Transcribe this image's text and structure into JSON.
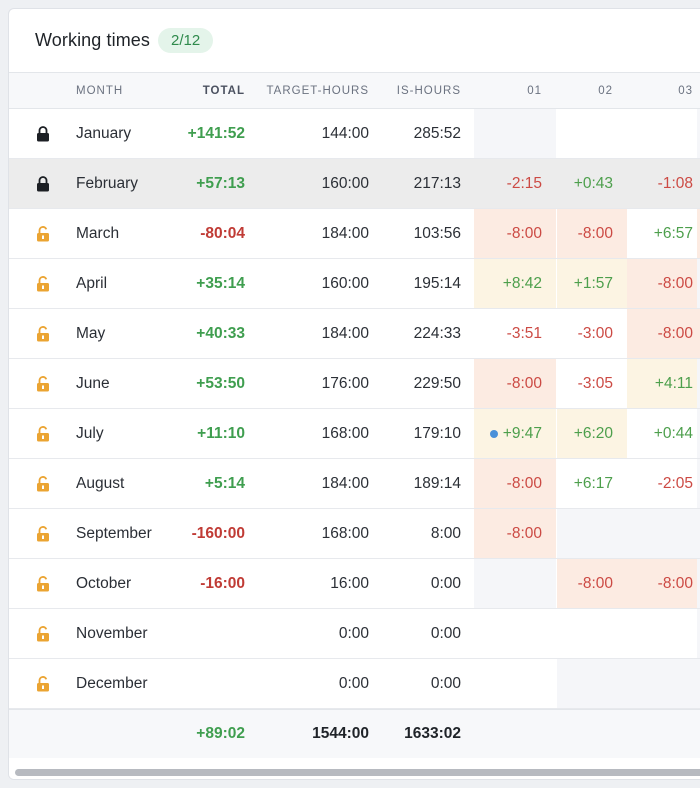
{
  "header": {
    "title": "Working times",
    "badge": "2/12"
  },
  "columns": {
    "month": "MONTH",
    "total": "TOTAL",
    "target": "TARGET-HOURS",
    "is": "IS-HOURS",
    "day1": "01",
    "day2": "02",
    "day3": "03"
  },
  "rows": [
    {
      "lock": "locked",
      "month": "January",
      "total": "+141:52",
      "target": "144:00",
      "is": "285:52",
      "d1": "",
      "d2": "",
      "d3": ""
    },
    {
      "lock": "locked",
      "month": "February",
      "total": "+57:13",
      "target": "160:00",
      "is": "217:13",
      "d1": "-2:15",
      "d2": "+0:43",
      "d3": "-1:08"
    },
    {
      "lock": "unlocked",
      "month": "March",
      "total": "-80:04",
      "target": "184:00",
      "is": "103:56",
      "d1": "-8:00",
      "d2": "-8:00",
      "d3": "+6:57"
    },
    {
      "lock": "unlocked",
      "month": "April",
      "total": "+35:14",
      "target": "160:00",
      "is": "195:14",
      "d1": "+8:42",
      "d2": "+1:57",
      "d3": "-8:00"
    },
    {
      "lock": "unlocked",
      "month": "May",
      "total": "+40:33",
      "target": "184:00",
      "is": "224:33",
      "d1": "-3:51",
      "d2": "-3:00",
      "d3": "-8:00"
    },
    {
      "lock": "unlocked",
      "month": "June",
      "total": "+53:50",
      "target": "176:00",
      "is": "229:50",
      "d1": "-8:00",
      "d2": "-3:05",
      "d3": "+4:11"
    },
    {
      "lock": "unlocked",
      "month": "July",
      "total": "+11:10",
      "target": "168:00",
      "is": "179:10",
      "d1": "+9:47",
      "d2": "+6:20",
      "d3": "+0:44"
    },
    {
      "lock": "unlocked",
      "month": "August",
      "total": "+5:14",
      "target": "184:00",
      "is": "189:14",
      "d1": "-8:00",
      "d2": "+6:17",
      "d3": "-2:05"
    },
    {
      "lock": "unlocked",
      "month": "September",
      "total": "-160:00",
      "target": "168:00",
      "is": "8:00",
      "d1": "-8:00",
      "d2": "",
      "d3": ""
    },
    {
      "lock": "unlocked",
      "month": "October",
      "total": "-16:00",
      "target": "16:00",
      "is": "0:00",
      "d1": "",
      "d2": "-8:00",
      "d3": "-8:00"
    },
    {
      "lock": "unlocked",
      "month": "November",
      "total": "",
      "target": "0:00",
      "is": "0:00",
      "d1": "",
      "d2": "",
      "d3": ""
    },
    {
      "lock": "unlocked",
      "month": "December",
      "total": "",
      "target": "0:00",
      "is": "0:00",
      "d1": "",
      "d2": "",
      "d3": ""
    }
  ],
  "footer": {
    "total": "+89:02",
    "target": "1544:00",
    "is": "1633:02"
  },
  "colors": {
    "positive": "#3f9e4f",
    "negative": "#c03b35",
    "locked_icon": "#1c1f24",
    "unlocked_icon": "#eba432",
    "badge_bg": "#e4f4ea",
    "today_dot": "#4a90d9"
  },
  "icons": {
    "locked": "lock-closed-icon",
    "unlocked": "lock-open-icon"
  }
}
